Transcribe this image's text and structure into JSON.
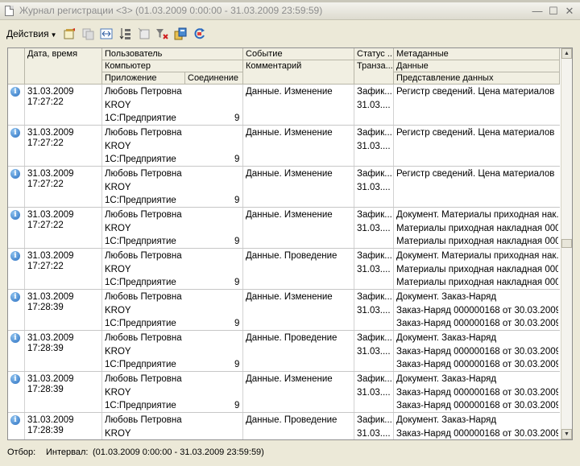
{
  "window": {
    "title": "Журнал регистрации <3> (01.03.2009 0:00:00 - 31.03.2009 23:59:59)",
    "minimize": "—",
    "maximize": "☐",
    "close": "✕"
  },
  "toolbar": {
    "actions_label": "Действия",
    "icons": [
      "open-record-icon",
      "copy-icon",
      "interval-icon",
      "sort-icon",
      "configure-list-icon",
      "clear-filter-icon",
      "export-icon",
      "refresh-icon"
    ]
  },
  "headers": {
    "datetime": "Дата, время",
    "user": "Пользователь",
    "computer": "Компьютер",
    "application": "Приложение",
    "connection": "Соединение",
    "event": "Событие",
    "comment": "Комментарий",
    "status": "Статус ...",
    "transaction": "Транза...",
    "metadata": "Метаданные",
    "data": "Данные",
    "data_presentation": "Представление данных"
  },
  "rows": [
    {
      "date": "31.03.2009",
      "time": "17:27:22",
      "user": "Любовь Петровна",
      "computer": "KROY",
      "app": "1С:Предприятие",
      "conn": "9",
      "event": "Данные. Изменение",
      "status": "Зафик...",
      "trans": "31.03....",
      "meta": [
        "Регистр сведений. Цена материалов",
        "",
        ""
      ]
    },
    {
      "date": "31.03.2009",
      "time": "17:27:22",
      "user": "Любовь Петровна",
      "computer": "KROY",
      "app": "1С:Предприятие",
      "conn": "9",
      "event": "Данные. Изменение",
      "status": "Зафик...",
      "trans": "31.03....",
      "meta": [
        "Регистр сведений. Цена материалов",
        "",
        ""
      ]
    },
    {
      "date": "31.03.2009",
      "time": "17:27:22",
      "user": "Любовь Петровна",
      "computer": "KROY",
      "app": "1С:Предприятие",
      "conn": "9",
      "event": "Данные. Изменение",
      "status": "Зафик...",
      "trans": "31.03....",
      "meta": [
        "Регистр сведений. Цена материалов",
        "",
        ""
      ]
    },
    {
      "date": "31.03.2009",
      "time": "17:27:22",
      "user": "Любовь Петровна",
      "computer": "KROY",
      "app": "1С:Предприятие",
      "conn": "9",
      "event": "Данные. Изменение",
      "status": "Зафик...",
      "trans": "31.03....",
      "meta": [
        "Документ. Материалы приходная нак...",
        "Материалы приходная накладная 000...",
        "Материалы приходная накладная 000..."
      ]
    },
    {
      "date": "31.03.2009",
      "time": "17:27:22",
      "user": "Любовь Петровна",
      "computer": "KROY",
      "app": "1С:Предприятие",
      "conn": "9",
      "event": "Данные. Проведение",
      "status": "Зафик...",
      "trans": "31.03....",
      "meta": [
        "Документ. Материалы приходная нак...",
        "Материалы приходная накладная 000...",
        "Материалы приходная накладная 000..."
      ]
    },
    {
      "date": "31.03.2009",
      "time": "17:28:39",
      "user": "Любовь Петровна",
      "computer": "KROY",
      "app": "1С:Предприятие",
      "conn": "9",
      "event": "Данные. Изменение",
      "status": "Зафик...",
      "trans": "31.03....",
      "meta": [
        "Документ. Заказ-Наряд",
        "Заказ-Наряд 000000168 от 30.03.2009...",
        "Заказ-Наряд 000000168 от 30.03.2009..."
      ]
    },
    {
      "date": "31.03.2009",
      "time": "17:28:39",
      "user": "Любовь Петровна",
      "computer": "KROY",
      "app": "1С:Предприятие",
      "conn": "9",
      "event": "Данные. Проведение",
      "status": "Зафик...",
      "trans": "31.03....",
      "meta": [
        "Документ. Заказ-Наряд",
        "Заказ-Наряд 000000168 от 30.03.2009...",
        "Заказ-Наряд 000000168 от 30.03.2009..."
      ]
    },
    {
      "date": "31.03.2009",
      "time": "17:28:39",
      "user": "Любовь Петровна",
      "computer": "KROY",
      "app": "1С:Предприятие",
      "conn": "9",
      "event": "Данные. Изменение",
      "status": "Зафик...",
      "trans": "31.03....",
      "meta": [
        "Документ. Заказ-Наряд",
        "Заказ-Наряд 000000168 от 30.03.2009...",
        "Заказ-Наряд 000000168 от 30.03.2009..."
      ]
    },
    {
      "date": "31.03.2009",
      "time": "17:28:39",
      "user": "Любовь Петровна",
      "computer": "KROY",
      "app": "1С:Предприятие",
      "conn": "9",
      "event": "Данные. Проведение",
      "status": "Зафик...",
      "trans": "31.03....",
      "meta": [
        "Документ. Заказ-Наряд",
        "Заказ-Наряд 000000168 от 30.03.2009...",
        ""
      ]
    }
  ],
  "statusbar": {
    "filter_label": "Отбор:",
    "interval_label": "Интервал:",
    "interval_value": "(01.03.2009 0:00:00 - 31.03.2009 23:59:59)"
  },
  "colors": {
    "window_bg": "#ece9d8",
    "header_bg": "#f1efe2",
    "info_icon": "#2a6fc0"
  }
}
